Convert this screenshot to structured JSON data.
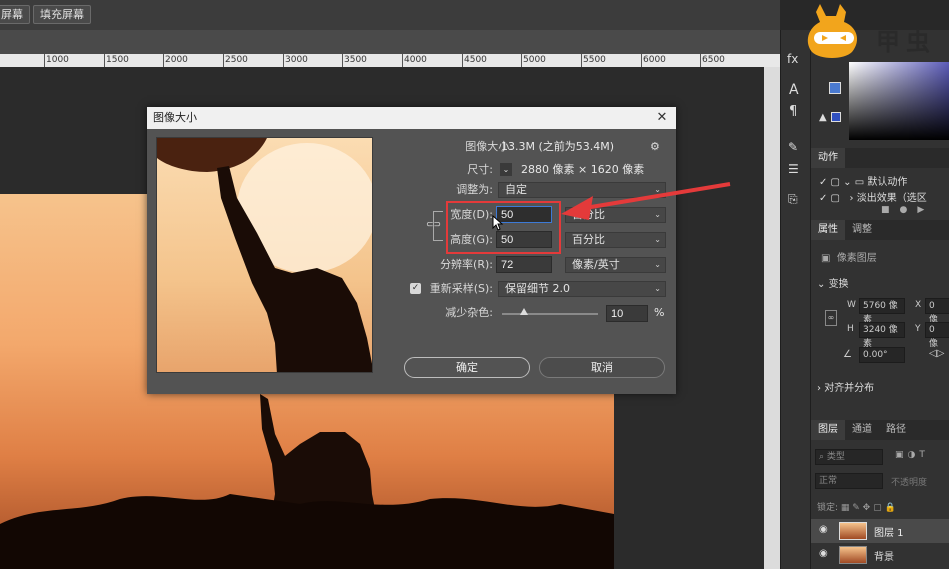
{
  "toolbar": {
    "btn1": "屏幕",
    "btn2": "填充屏幕"
  },
  "ruler": {
    "ticks": [
      "1000",
      "1500",
      "2000",
      "2500",
      "3000",
      "3500",
      "4000",
      "4500",
      "5000",
      "5500",
      "6000",
      "6500"
    ]
  },
  "logo": {
    "text": "甲虫"
  },
  "dialog": {
    "title": "图像大小",
    "image_size_label": "图像大小:",
    "image_size_value": "13.3M (之前为53.4M)",
    "dimension_label": "尺寸:",
    "dimension_value": "2880 像素  ×  1620 像素",
    "fit_label": "调整为:",
    "fit_value": "自定",
    "width_label": "宽度(D):",
    "width_value": "50",
    "width_unit": "百分比",
    "height_label": "高度(G):",
    "height_value": "50",
    "height_unit": "百分比",
    "resolution_label": "分辨率(R):",
    "resolution_value": "72",
    "resolution_unit": "像素/英寸",
    "resample_label": "重新采样(S):",
    "resample_value": "保留细节 2.0",
    "noise_label": "减少杂色:",
    "noise_value": "10",
    "noise_unit": "%",
    "ok": "确定",
    "cancel": "取消"
  },
  "panels": {
    "actions_tab": "动作",
    "action_set": "默认动作",
    "action_item": "淡出效果（选区",
    "props_tab": "属性",
    "adjust_tab": "调整",
    "pixel_layer": "像素图层",
    "transform": "变换",
    "w_label": "W",
    "w_value": "5760 像素",
    "h_label": "H",
    "h_value": "3240 像素",
    "x_label": "X",
    "x_value": "0 像",
    "y_label": "Y",
    "y_value": "0 像",
    "angle_value": "0.00°",
    "align": "对齐并分布",
    "layers_tab": "图层",
    "channels_tab": "通道",
    "paths_tab": "路径",
    "kind": "类型",
    "blend": "正常",
    "opacity": "不透明度",
    "lock": "锁定:",
    "layer1": "图层 1",
    "layer_bg": "背景"
  },
  "colors": {
    "accent_blue": "#3d7ad6",
    "highlight_red": "#e43a3a"
  }
}
